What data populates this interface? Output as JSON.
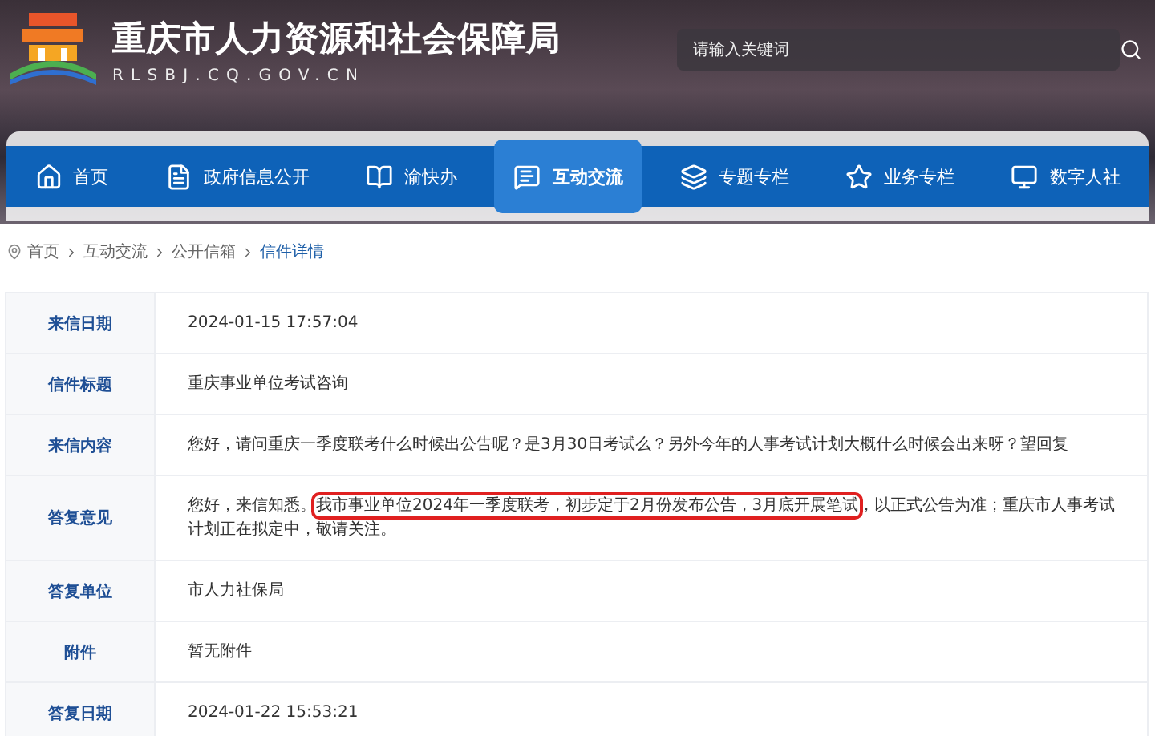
{
  "site": {
    "title": "重庆市人力资源和社会保障局",
    "domain": "RLSBJ.CQ.GOV.CN"
  },
  "search": {
    "placeholder": "请输入关键词"
  },
  "nav": [
    {
      "label": "首页",
      "kind": "home",
      "selected": false
    },
    {
      "label": "政府信息公开",
      "kind": "document",
      "selected": false
    },
    {
      "label": "渝快办",
      "kind": "book",
      "selected": false
    },
    {
      "label": "互动交流",
      "kind": "chat",
      "selected": true
    },
    {
      "label": "专题专栏",
      "kind": "layers",
      "selected": false
    },
    {
      "label": "业务专栏",
      "kind": "star",
      "selected": false
    },
    {
      "label": "数字人社",
      "kind": "monitor",
      "selected": false
    }
  ],
  "breadcrumb": [
    {
      "label": "首页",
      "current": false
    },
    {
      "label": "互动交流",
      "current": false
    },
    {
      "label": "公开信箱",
      "current": false
    },
    {
      "label": "信件详情",
      "current": true
    }
  ],
  "rows": [
    {
      "label": "来信日期",
      "segments": [
        {
          "text": "2024-01-15 17:57:04",
          "highlighted": false
        }
      ]
    },
    {
      "label": "信件标题",
      "segments": [
        {
          "text": "重庆事业单位考试咨询",
          "highlighted": false
        }
      ]
    },
    {
      "label": "来信内容",
      "segments": [
        {
          "text": "您好，请问重庆一季度联考什么时候出公告呢？是3月30日考试么？另外今年的人事考试计划大概什么时候会出来呀？望回复",
          "highlighted": false
        }
      ]
    },
    {
      "label": "答复意见",
      "segments": [
        {
          "text": "您好，来信知悉。",
          "highlighted": false
        },
        {
          "text": "我市事业单位2024年一季度联考，初步定于2月份发布公告，3月底开展笔试",
          "highlighted": true
        },
        {
          "text": "，以正式公告为准；重庆市人事考试计划正在拟定中，敬请关注。",
          "highlighted": false
        }
      ]
    },
    {
      "label": "答复单位",
      "segments": [
        {
          "text": "市人力社保局",
          "highlighted": false
        }
      ]
    },
    {
      "label": "附件",
      "segments": [
        {
          "text": "暂无附件",
          "highlighted": false
        }
      ]
    },
    {
      "label": "答复日期",
      "segments": [
        {
          "text": "2024-01-22 15:53:21",
          "highlighted": false
        }
      ]
    }
  ]
}
